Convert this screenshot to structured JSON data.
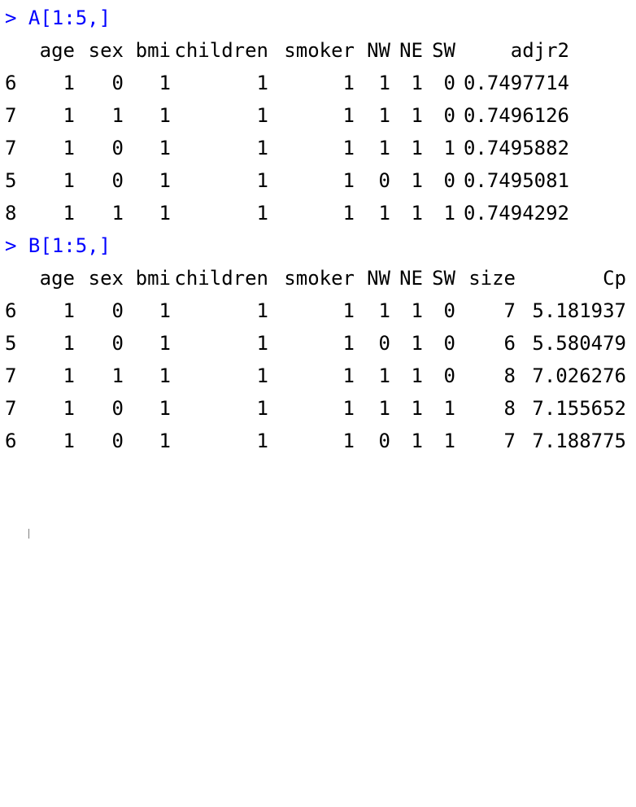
{
  "prompts": {
    "command_a": "> A[1:5,]",
    "command_b": "> B[1:5,]"
  },
  "table_a": {
    "headers": [
      "age",
      "sex",
      "bmi",
      "children",
      "smoker",
      "NW",
      "NE",
      "SW",
      "adjr2"
    ],
    "rows": [
      {
        "name": "6",
        "cells": [
          "1",
          "0",
          "1",
          "1",
          "1",
          "1",
          "1",
          "0",
          "0.7497714"
        ]
      },
      {
        "name": "7",
        "cells": [
          "1",
          "1",
          "1",
          "1",
          "1",
          "1",
          "1",
          "0",
          "0.7496126"
        ]
      },
      {
        "name": "7",
        "cells": [
          "1",
          "0",
          "1",
          "1",
          "1",
          "1",
          "1",
          "1",
          "0.7495882"
        ]
      },
      {
        "name": "5",
        "cells": [
          "1",
          "0",
          "1",
          "1",
          "1",
          "0",
          "1",
          "0",
          "0.7495081"
        ]
      },
      {
        "name": "8",
        "cells": [
          "1",
          "1",
          "1",
          "1",
          "1",
          "1",
          "1",
          "1",
          "0.7494292"
        ]
      }
    ]
  },
  "table_b": {
    "headers": [
      "age",
      "sex",
      "bmi",
      "children",
      "smoker",
      "NW",
      "NE",
      "SW",
      "size",
      "Cp"
    ],
    "rows": [
      {
        "name": "6",
        "cells": [
          "1",
          "0",
          "1",
          "1",
          "1",
          "1",
          "1",
          "0",
          "7",
          "5.181937"
        ]
      },
      {
        "name": "5",
        "cells": [
          "1",
          "0",
          "1",
          "1",
          "1",
          "0",
          "1",
          "0",
          "6",
          "5.580479"
        ]
      },
      {
        "name": "7",
        "cells": [
          "1",
          "1",
          "1",
          "1",
          "1",
          "1",
          "1",
          "0",
          "8",
          "7.026276"
        ]
      },
      {
        "name": "7",
        "cells": [
          "1",
          "0",
          "1",
          "1",
          "1",
          "1",
          "1",
          "1",
          "8",
          "7.155652"
        ]
      },
      {
        "name": "6",
        "cells": [
          "1",
          "0",
          "1",
          "1",
          "1",
          "0",
          "1",
          "1",
          "7",
          "7.188775"
        ]
      }
    ]
  }
}
